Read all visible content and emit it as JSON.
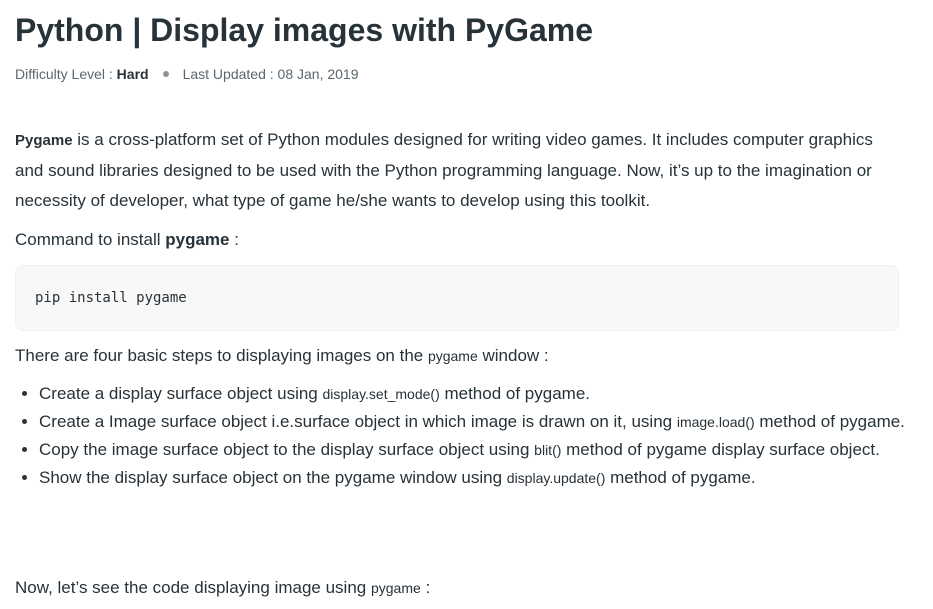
{
  "article": {
    "title": "Python | Display images with PyGame",
    "meta": {
      "difficulty_label": "Difficulty Level : ",
      "difficulty_value": "Hard",
      "updated_label": "Last Updated : 08 Jan, 2019"
    },
    "intro": {
      "lead_bold": "Pygame",
      "text": " is a cross-platform set of Python modules designed for writing video games. It includes computer graphics and sound libraries designed to be used with the Python programming language. Now, it’s up to the imagination or necessity of developer, what type of game he/she wants to develop using this toolkit."
    },
    "install": {
      "text": "Command to install ",
      "bold": "pygame",
      "suffix": " :"
    },
    "code": "pip install pygame",
    "steps_intro": {
      "text": "There are four basic steps to displaying images on the ",
      "code": "pygame",
      "suffix": " window :"
    },
    "steps": [
      {
        "before": "Create a display surface object using ",
        "code": "display.set_mode()",
        "after": " method of pygame."
      },
      {
        "before": "Create a Image surface object i.e.surface object in which image is drawn on it, using ",
        "code": "image.load()",
        "after": " method of pygame."
      },
      {
        "before": "Copy the image surface object to the display surface object using ",
        "code": "blit()",
        "after": " method of pygame display surface object."
      },
      {
        "before": "Show the display surface object on the pygame window using ",
        "code": "display.update()",
        "after": " method of pygame."
      }
    ],
    "outro": {
      "text": "Now, let’s see the code displaying image using ",
      "code": "pygame",
      "suffix": " :"
    }
  }
}
